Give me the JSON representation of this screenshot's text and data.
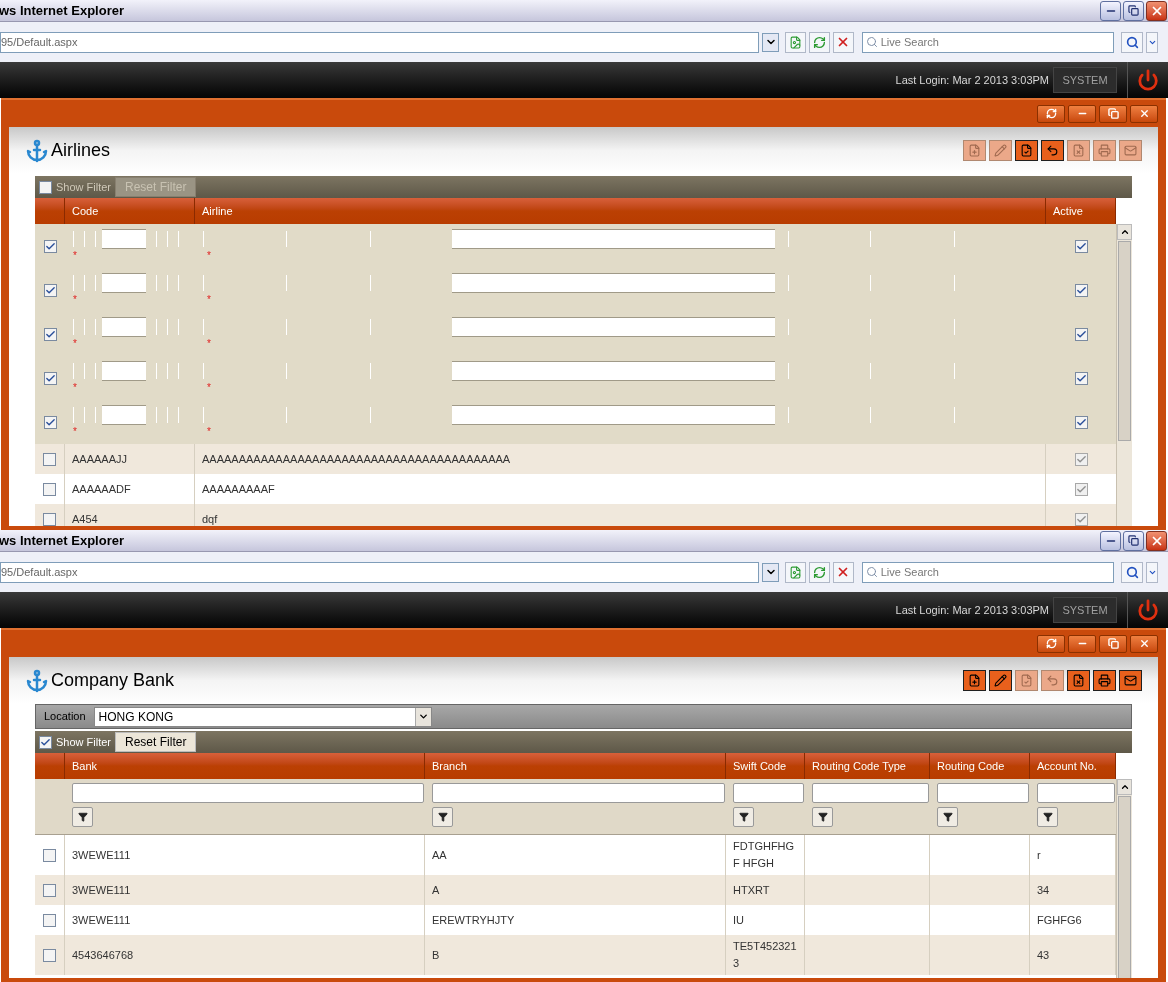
{
  "windows": [
    {
      "browser": {
        "title": "ws Internet Explorer",
        "address": "95/Default.aspx",
        "search_placeholder": "Live Search"
      },
      "app_bar": {
        "last_login": "Last Login: Mar 2 2013 3:03PM",
        "user": "SYSTEM"
      },
      "page": {
        "title": "Airlines",
        "toolbar": [
          {
            "kind": "add",
            "enabled": false
          },
          {
            "kind": "edit",
            "enabled": false
          },
          {
            "kind": "save",
            "enabled": true
          },
          {
            "kind": "undo",
            "enabled": true
          },
          {
            "kind": "delete",
            "enabled": false
          },
          {
            "kind": "print",
            "enabled": false
          },
          {
            "kind": "mail",
            "enabled": false
          }
        ],
        "filter": {
          "show_filter": false,
          "label": "Show Filter",
          "reset": "Reset Filter",
          "reset_enabled": false
        },
        "grid": {
          "kind": "airlines",
          "columns": [
            "Code",
            "Airline",
            "Active"
          ],
          "edit_rows": [
            {
              "selected": true,
              "active": true,
              "marks": [
                "*",
                "*"
              ]
            },
            {
              "selected": true,
              "active": true,
              "marks": [
                "*",
                "*"
              ]
            },
            {
              "selected": true,
              "active": true,
              "marks": [
                "*",
                "*"
              ]
            },
            {
              "selected": true,
              "active": true,
              "marks": [
                "*",
                "*"
              ]
            },
            {
              "selected": true,
              "active": true,
              "marks": [
                "*",
                "*"
              ]
            }
          ],
          "rows": [
            {
              "selected": false,
              "active": true,
              "cells": [
                "AAAAAAJJ",
                "AAAAAAAAAAAAAAAAAAAAAAAAAAAAAAAAAAAAAAAAAA"
              ]
            },
            {
              "selected": false,
              "active": true,
              "cells": [
                "AAAAAADF",
                "AAAAAAAAAF"
              ]
            },
            {
              "selected": false,
              "active": true,
              "cells": [
                "A454",
                "dqf"
              ]
            }
          ]
        }
      }
    },
    {
      "browser": {
        "title": "ws Internet Explorer",
        "address": "95/Default.aspx",
        "search_placeholder": "Live Search"
      },
      "app_bar": {
        "last_login": "Last Login: Mar 2 2013 3:03PM",
        "user": "SYSTEM"
      },
      "page": {
        "title": "Company Bank",
        "toolbar": [
          {
            "kind": "add",
            "enabled": true
          },
          {
            "kind": "edit",
            "enabled": true
          },
          {
            "kind": "save",
            "enabled": false
          },
          {
            "kind": "undo",
            "enabled": false
          },
          {
            "kind": "delete",
            "enabled": true
          },
          {
            "kind": "print",
            "enabled": true
          },
          {
            "kind": "mail",
            "enabled": true
          }
        ],
        "location": {
          "label": "Location",
          "value": "HONG KONG"
        },
        "filter": {
          "show_filter": true,
          "label": "Show Filter",
          "reset": "Reset Filter",
          "reset_enabled": true
        },
        "grid": {
          "kind": "bank",
          "columns": [
            "Bank",
            "Branch",
            "Swift Code",
            "Routing Code Type",
            "Routing Code",
            "Account No."
          ],
          "rows": [
            {
              "selected": false,
              "cells": [
                "3WEWE111",
                "AA",
                "FDTGHFHGF HFGH",
                "",
                "",
                "r"
              ]
            },
            {
              "selected": false,
              "cells": [
                "3WEWE111",
                "A",
                "HTXRT",
                "",
                "",
                "34"
              ]
            },
            {
              "selected": false,
              "cells": [
                "3WEWE111",
                "EREWTRYHJTY",
                "IU",
                "",
                "",
                "FGHFG6"
              ]
            },
            {
              "selected": false,
              "cells": [
                "4543646768",
                "B",
                "TE5T452321 3",
                "",
                "",
                "43"
              ]
            }
          ]
        }
      }
    }
  ]
}
